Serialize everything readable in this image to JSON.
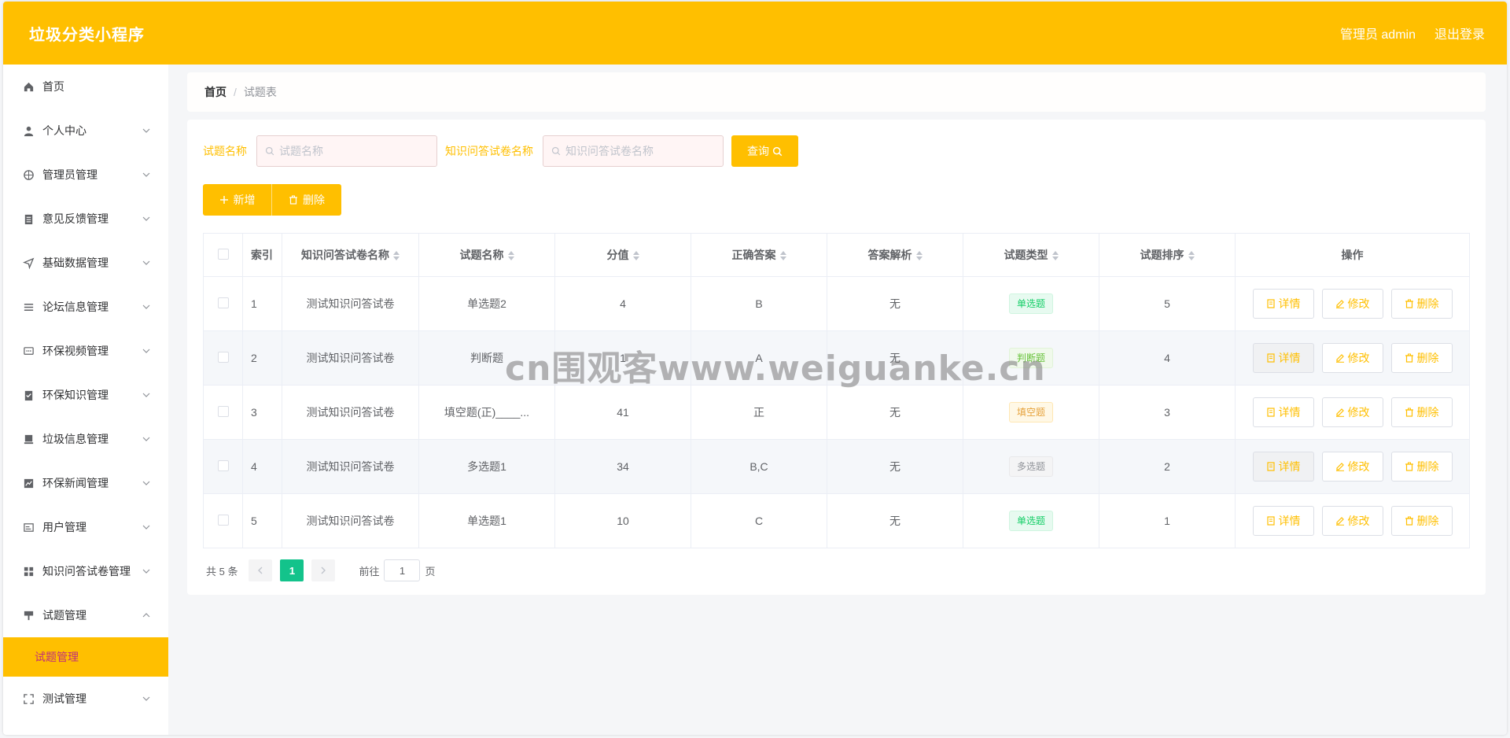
{
  "app": {
    "title": "垃圾分类小程序",
    "user_label": "管理员 admin",
    "logout_label": "退出登录",
    "accent_color": "#ffbf00"
  },
  "sidebar": {
    "items": [
      {
        "label": "首页",
        "icon": "home-icon"
      },
      {
        "label": "个人中心",
        "icon": "user-icon"
      },
      {
        "label": "管理员管理",
        "icon": "compass-icon"
      },
      {
        "label": "意见反馈管理",
        "icon": "clipboard-icon"
      },
      {
        "label": "基础数据管理",
        "icon": "send-icon"
      },
      {
        "label": "论坛信息管理",
        "icon": "list-icon"
      },
      {
        "label": "环保视频管理",
        "icon": "chat-icon"
      },
      {
        "label": "环保知识管理",
        "icon": "checklist-icon"
      },
      {
        "label": "垃圾信息管理",
        "icon": "monitor-icon"
      },
      {
        "label": "环保新闻管理",
        "icon": "chart-icon"
      },
      {
        "label": "用户管理",
        "icon": "id-card-icon"
      },
      {
        "label": "知识问答试卷管理",
        "icon": "grid-icon"
      },
      {
        "label": "试题管理",
        "icon": "brush-icon"
      },
      {
        "label": "测试管理",
        "icon": "fullscreen-icon"
      }
    ],
    "active_sub": "试题管理"
  },
  "breadcrumb": {
    "home": "首页",
    "separator": "/",
    "current": "试题表"
  },
  "search": {
    "label1": "试题名称",
    "placeholder1": "试题名称",
    "label2": "知识问答试卷名称",
    "placeholder2": "知识问答试卷名称",
    "query_label": "查询"
  },
  "actions": {
    "add_label": "新增",
    "delete_label": "删除"
  },
  "table": {
    "headers": {
      "index": "索引",
      "paper": "知识问答试卷名称",
      "name": "试题名称",
      "score": "分值",
      "answer": "正确答案",
      "analysis": "答案解析",
      "type": "试题类型",
      "order": "试题排序",
      "ops": "操作"
    },
    "rows": [
      {
        "index": "1",
        "paper": "测试知识问答试卷",
        "name": "单选题2",
        "score": "4",
        "answer": "B",
        "analysis": "无",
        "type": "单选题",
        "order": "5"
      },
      {
        "index": "2",
        "paper": "测试知识问答试卷",
        "name": "判断题",
        "score": "1",
        "answer": "A",
        "analysis": "无",
        "type": "判断题",
        "order": "4"
      },
      {
        "index": "3",
        "paper": "测试知识问答试卷",
        "name": "填空题(正)____...",
        "score": "41",
        "answer": "正",
        "analysis": "无",
        "type": "填空题",
        "order": "3"
      },
      {
        "index": "4",
        "paper": "测试知识问答试卷",
        "name": "多选题1",
        "score": "34",
        "answer": "B,C",
        "analysis": "无",
        "type": "多选题",
        "order": "2"
      },
      {
        "index": "5",
        "paper": "测试知识问答试卷",
        "name": "单选题1",
        "score": "10",
        "answer": "C",
        "analysis": "无",
        "type": "单选题",
        "order": "1"
      }
    ],
    "op_labels": {
      "detail": "详情",
      "edit": "修改",
      "delete": "删除"
    }
  },
  "pager": {
    "total": "共 5 条",
    "current": "1",
    "goto_prefix": "前往",
    "goto_suffix": "页",
    "goto_value": "1"
  },
  "watermark": "cn围观客www.weiguanke.cn"
}
